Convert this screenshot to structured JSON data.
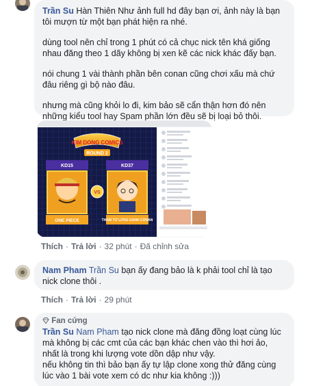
{
  "comment1": {
    "author": "Trần Su",
    "paragraphs": [
      "Hàn Thiên Như ảnh full hd đây bạn ơi, ảnh này là bạn tôi mượn từ một bạn phát hiện ra nhé.",
      "dùng tool nên chỉ trong 1 phút có cả chục nick tên khá giống nhau đăng theo 1 dãy không bị xen kẽ các nick khác đấy bạn.",
      "nói chung 1 vài thành phần bên conan cũng chơi xấu mà chứ đâu riêng gì bộ nào đâu.",
      "nhưng mà cũng khỏi lo đi, kim bảo sẽ cẩn thận hơn đó nên những kiểu tool hay Spam phần lớn đều sẽ bị loại bỏ thôi."
    ],
    "actions": {
      "like": "Thích",
      "reply": "Trả lời",
      "time": "32 phút",
      "edited": "Đã chỉnh sửa"
    }
  },
  "image": {
    "banner": "KIM DONG COMICS",
    "round": "ROUND 2",
    "left_code": "KD15",
    "right_code": "KD37",
    "left_title": "ONE PIECE",
    "right_title": "THÁM TỬ LỪNG DANH CONAN",
    "vs": "VS"
  },
  "comment2": {
    "author": "Nam Pham",
    "tag": "Trần Su",
    "text": "bạn ấy đang bảo là k phải tool chỉ là tạo nick clone thôi .",
    "actions": {
      "like": "Thích",
      "reply": "Trả lời",
      "time": "29 phút"
    }
  },
  "comment3": {
    "badge": "Fan cứng",
    "author": "Trần Su",
    "tag": "Nam Pham",
    "text_line1": "tạo nick clone mà đăng đồng loạt cùng lúc mà không bị các cmt của các bạn khác chen vào thì hơi ảo, nhất là trong khi lượng vote dồn dập như vậy.",
    "text_line2": "nếu không tin thì bảo bạn ấy tự lập clone xong thử đăng cùng lúc vào 1 bài vote xem có dc như kia không :)))"
  }
}
